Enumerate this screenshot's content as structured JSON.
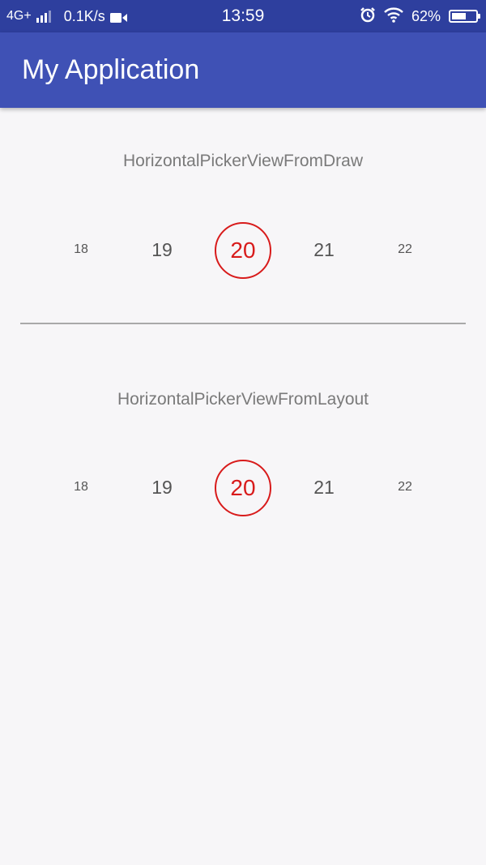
{
  "status_bar": {
    "network": "4G+",
    "speed": "0.1K/s",
    "time": "13:59",
    "battery": "62%",
    "battery_level": 0.62,
    "icons": [
      "signal-icon",
      "video-icon",
      "alarm-icon",
      "wifi-icon",
      "battery-icon"
    ]
  },
  "app_bar": {
    "title": "My Application",
    "color": "#3f51b5"
  },
  "picker_draw": {
    "title": "HorizontalPickerViewFromDraw",
    "items": [
      "18",
      "19",
      "20",
      "21",
      "22"
    ],
    "selected": "20"
  },
  "picker_layout": {
    "title": "HorizontalPickerViewFromLayout",
    "items": [
      "18",
      "19",
      "20",
      "21",
      "22"
    ],
    "selected": "20"
  },
  "colors": {
    "status_bar": "#2e3f9e",
    "accent": "#d81b1b",
    "background": "#f7f6f8"
  }
}
